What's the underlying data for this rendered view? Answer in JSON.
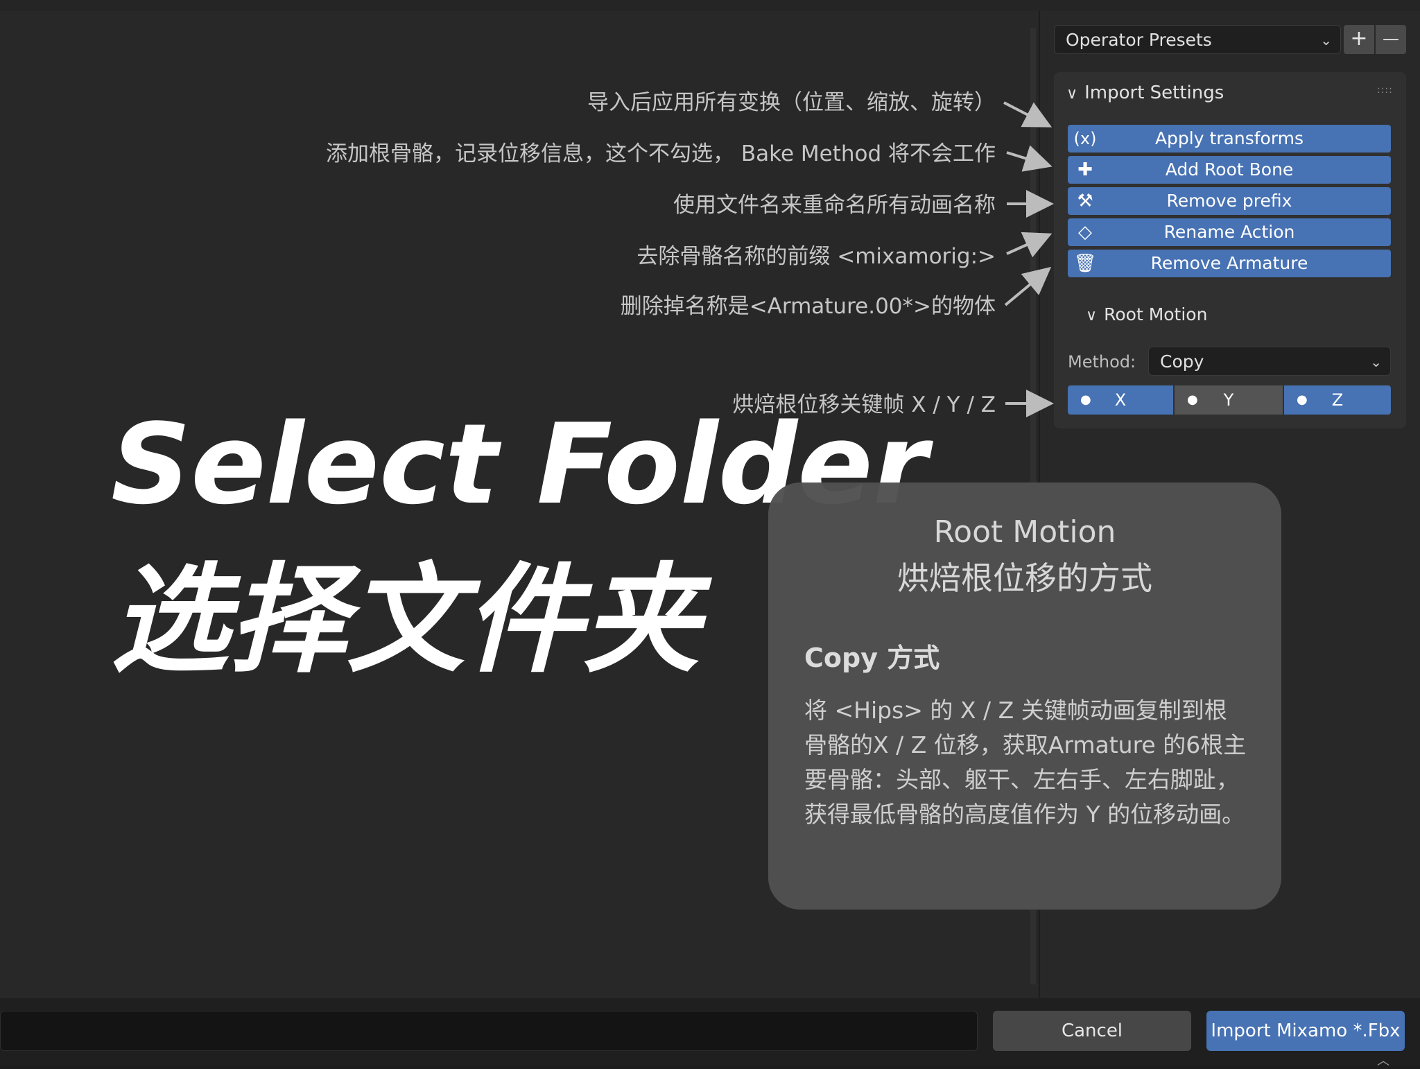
{
  "annotations": [
    "导入后应用所有变换（位置、缩放、旋转）",
    "添加根骨骼，记录位移信息，这个不勾选， Bake Method 将不会工作",
    "使用文件名来重命名所有动画名称",
    "去除骨骼名称的前缀 <mixamorig:>",
    "删除掉名称是<Armature.00*>的物体",
    "烘焙根位移关键帧 X / Y / Z"
  ],
  "title": {
    "line1": "Select Folder",
    "line2": "选择文件夹"
  },
  "presets": {
    "label": "Operator Presets",
    "add": "+",
    "remove": "—"
  },
  "settings": {
    "header": "Import Settings",
    "buttons": [
      {
        "label": "Apply transforms",
        "icon": "variable-icon"
      },
      {
        "label": "Add Root Bone",
        "icon": "bone-add-icon"
      },
      {
        "label": "Remove prefix",
        "icon": "bone-icon"
      },
      {
        "label": "Rename Action",
        "icon": "action-icon"
      },
      {
        "label": "Remove Armature",
        "icon": "trash-icon"
      }
    ],
    "root_motion": {
      "header": "Root Motion",
      "method_label": "Method:",
      "method_value": "Copy",
      "axes": [
        "X",
        "Y",
        "Z"
      ]
    }
  },
  "tooltip": {
    "title": "Root Motion",
    "subtitle": "烘焙根位移的方式",
    "heading": "Copy 方式",
    "body": "将 <Hips> 的  X / Z 关键帧动画复制到根骨骼的X / Z 位移，获取Armature 的6根主要骨骼：头部、躯干、左右手、左右脚趾，获得最低骨骼的高度值作为 Y 的位移动画。"
  },
  "footer": {
    "cancel": "Cancel",
    "import": "Import Mixamo *.Fbx"
  },
  "colors": {
    "accent": "#4772b3",
    "background": "#282828"
  }
}
